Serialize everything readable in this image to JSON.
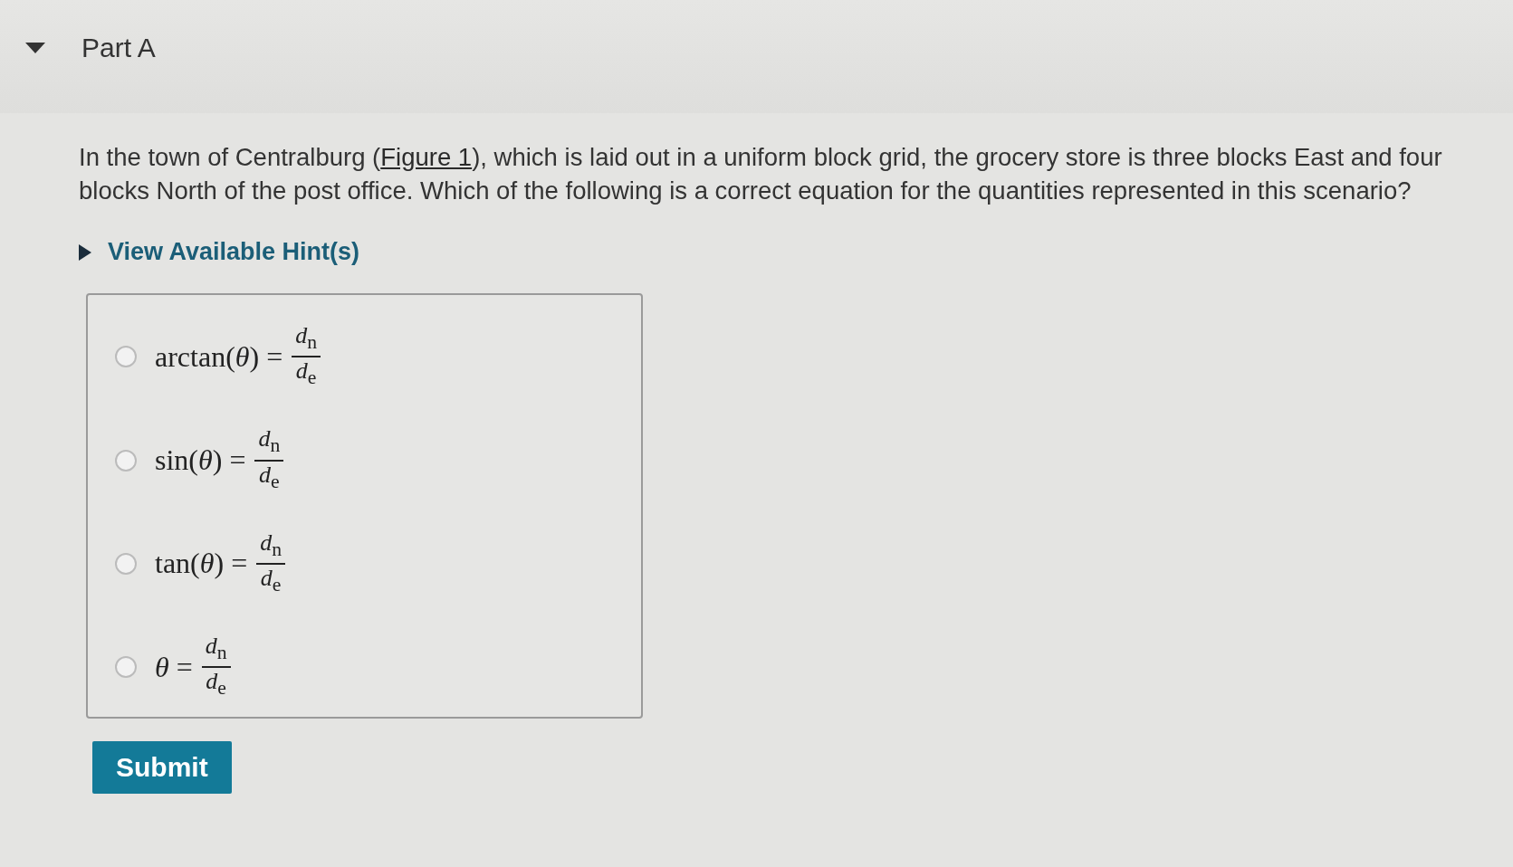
{
  "section": {
    "title": "Part A",
    "expanded": true
  },
  "question": {
    "before_link": "In the town of Centralburg (",
    "link": "Figure 1",
    "after_link": "), which is laid out in a uniform block grid, the grocery store is three blocks East and four blocks North of the post office. Which of the following is a correct equation for the quantities represented in this scenario?"
  },
  "hints": {
    "label": "View Available Hint(s)",
    "expanded": false
  },
  "options": [
    {
      "lhs": "arctan(*θ*) =",
      "numerator": "*d*$_{n}$",
      "denominator": "*d*$_{e}$",
      "selected": false
    },
    {
      "lhs": "sin(*θ*) =",
      "numerator": "*d*$_{n}$",
      "denominator": "*d*$_{e}$",
      "selected": false
    },
    {
      "lhs": "tan(*θ*) =",
      "numerator": "*d*$_{n}$",
      "denominator": "*d*$_{e}$",
      "selected": false
    },
    {
      "lhs": "*θ* =",
      "numerator": "*d*$_{n}$",
      "denominator": "*d*$_{e}$",
      "selected": false
    }
  ],
  "submit": {
    "label": "Submit"
  }
}
